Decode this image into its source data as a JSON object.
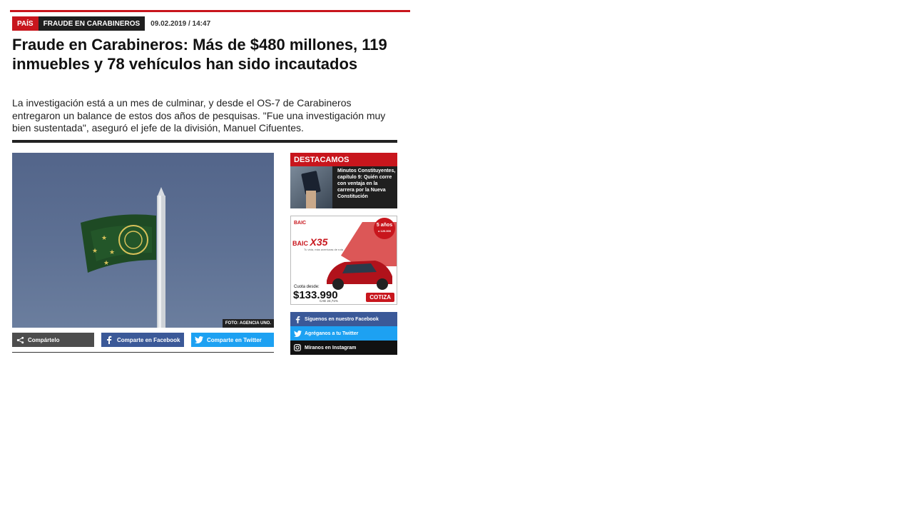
{
  "article": {
    "section": "PAÍS",
    "tag": "FRAUDE EN CARABINEROS",
    "date": "09.02.2019 / 14:47",
    "title": "Fraude en Carabineros: Más de $480 millones, 119 inmuebles y 78 vehículos han sido incautados",
    "lead": "La investigación está a un mes de culminar, y desde el OS-7 de Carabineros entregaron un balance de estos dos años de pesquisas. \"Fue una investigación muy bien sustentada\", aseguró el jefe de la división, Manuel Cifuentes.",
    "photo_credit": "FOTO: AGENCIA UNO."
  },
  "share": {
    "generic_label": "Compártelo",
    "facebook_label": "Comparte en Facebook",
    "twitter_label": "Comparte en Twitter"
  },
  "sidebar": {
    "destacamos": {
      "header": "DESTACAMOS",
      "title": "Minutos Constituyentes, capítulo 9: Quién corre con ventaja en la carrera por la Nueva Constitución"
    },
    "ad": {
      "brand": "BAIC",
      "model_prefix": "BAIC",
      "model": "X35",
      "tagline": "Tu vida, más aventuras de ruta",
      "badge_line1": "5 años",
      "badge_line2": "o 120.000",
      "cuota_label": "Cuota desde:",
      "price": "$133.990",
      "cae": "CAE 24,71%",
      "cta": "COTIZA"
    },
    "social": {
      "facebook": "Síguenos en nuestro Facebook",
      "twitter": "Agréganos a tu Twitter",
      "instagram": "Míranos en Instagram"
    }
  },
  "colors": {
    "accent": "#c8161d",
    "facebook": "#3b5998",
    "twitter": "#1da1f2",
    "dark": "#1f1f1f"
  },
  "icons": [
    "share-icon",
    "facebook-icon",
    "twitter-icon",
    "instagram-icon"
  ]
}
